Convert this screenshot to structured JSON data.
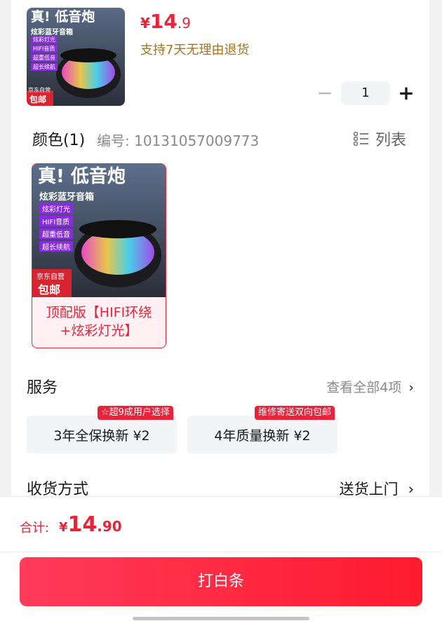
{
  "product": {
    "price_symbol": "¥",
    "price_int": "14",
    "price_dec": ".9",
    "return_policy": "支持7天无理由退货",
    "image_texts": {
      "headline": "真! 低音炮",
      "subline": "炫彩蓝牙音箱",
      "features": [
        "炫彩灯光",
        "HIFI音质",
        "超重低音",
        "超长续航"
      ],
      "brand_tag": "京东自营",
      "shipping_tag": "包邮"
    }
  },
  "quantity": {
    "minus": "−",
    "value": "1",
    "plus": "+"
  },
  "color_section": {
    "title": "颜色(1)",
    "sku_code": "编号: 10131057009773",
    "list_label": "列表",
    "variant": {
      "label_line1": "顶配版【HIFI环绕",
      "label_line2": "+炫彩灯光】"
    }
  },
  "service_section": {
    "title": "服务",
    "see_all": "查看全部4项",
    "chevron": "›",
    "options": [
      {
        "label": "3年全保换新  ¥2",
        "tag": "☆超9成用户选择"
      },
      {
        "label": "4年质量换新  ¥2",
        "tag": "维修寄送双向包邮"
      }
    ]
  },
  "delivery_section": {
    "title": "收货方式",
    "value": "送货上门",
    "chevron": "›"
  },
  "footer": {
    "total_label": "合计:",
    "total_symbol": "¥",
    "total_int": "14",
    "total_dec": ".90",
    "pay_button": "打白条"
  },
  "colors": {
    "accent": "#e8233a",
    "policy": "#a8741a"
  }
}
